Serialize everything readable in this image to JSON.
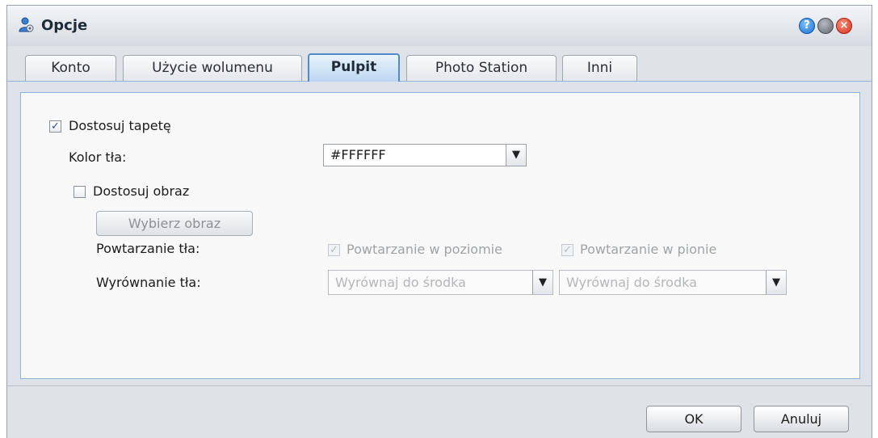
{
  "window": {
    "title": "Opcje",
    "icon": "user-settings-icon"
  },
  "controls": {
    "help_symbol": "?",
    "close_symbol": "×"
  },
  "tabs": [
    {
      "label": "Konto"
    },
    {
      "label": "Użycie wolumenu"
    },
    {
      "label": "Pulpit",
      "active": true
    },
    {
      "label": "Photo Station"
    },
    {
      "label": "Inni"
    }
  ],
  "form": {
    "customize_wallpaper": {
      "label": "Dostosuj tapetę",
      "checked": true
    },
    "bg_color": {
      "label": "Kolor tła:",
      "value": "#FFFFFF"
    },
    "customize_image": {
      "label": "Dostosuj obraz",
      "checked": false
    },
    "choose_image_button": "Wybierz obraz",
    "bg_repeat": {
      "label": "Powtarzanie tła:",
      "horizontal": {
        "label": "Powtarzanie w poziomie",
        "checked": true,
        "disabled": true
      },
      "vertical": {
        "label": "Powtarzanie w pionie",
        "checked": true,
        "disabled": true
      }
    },
    "bg_align": {
      "label": "Wyrównanie tła:",
      "select1": "Wyrównaj do środka",
      "select2": "Wyrównaj do środka"
    }
  },
  "footer": {
    "ok_label": "OK",
    "cancel_label": "Anuluj"
  },
  "colors": {
    "accent": "#4f8ccc",
    "panel_border": "#8fb4dc",
    "background": "#dde2e8"
  }
}
